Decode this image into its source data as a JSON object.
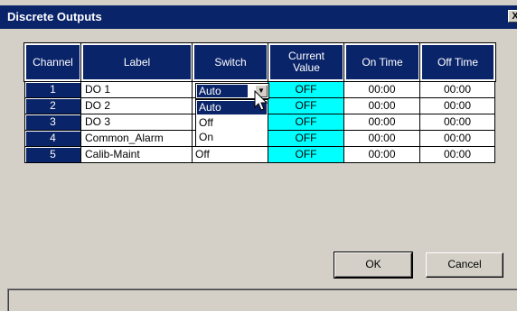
{
  "window": {
    "title": "Discrete Outputs",
    "close_label": "X"
  },
  "columns": [
    "Channel",
    "Label",
    "Switch",
    "Current Value",
    "On Time",
    "Off Time"
  ],
  "rows": [
    {
      "channel": "1",
      "label": "DO 1",
      "switch": "Auto",
      "current_value": "OFF",
      "on_time": "00:00",
      "off_time": "00:00"
    },
    {
      "channel": "2",
      "label": "DO 2",
      "switch": "",
      "current_value": "OFF",
      "on_time": "00:00",
      "off_time": "00:00"
    },
    {
      "channel": "3",
      "label": "DO 3",
      "switch": "",
      "current_value": "OFF",
      "on_time": "00:00",
      "off_time": "00:00"
    },
    {
      "channel": "4",
      "label": "Common_Alarm",
      "switch": "On",
      "current_value": "OFF",
      "on_time": "00:00",
      "off_time": "00:00"
    },
    {
      "channel": "5",
      "label": "Calib-Maint",
      "switch": "Off",
      "current_value": "OFF",
      "on_time": "00:00",
      "off_time": "00:00"
    }
  ],
  "switch_dropdown": {
    "selected": "Auto",
    "options": [
      "Auto",
      "Off",
      "On"
    ],
    "highlighted": "Auto"
  },
  "buttons": {
    "ok": "OK",
    "cancel": "Cancel"
  },
  "colors": {
    "title_bar": "#0a246a",
    "current_value_bg": "#00ffff",
    "dialog_bg": "#d4d0c8"
  }
}
